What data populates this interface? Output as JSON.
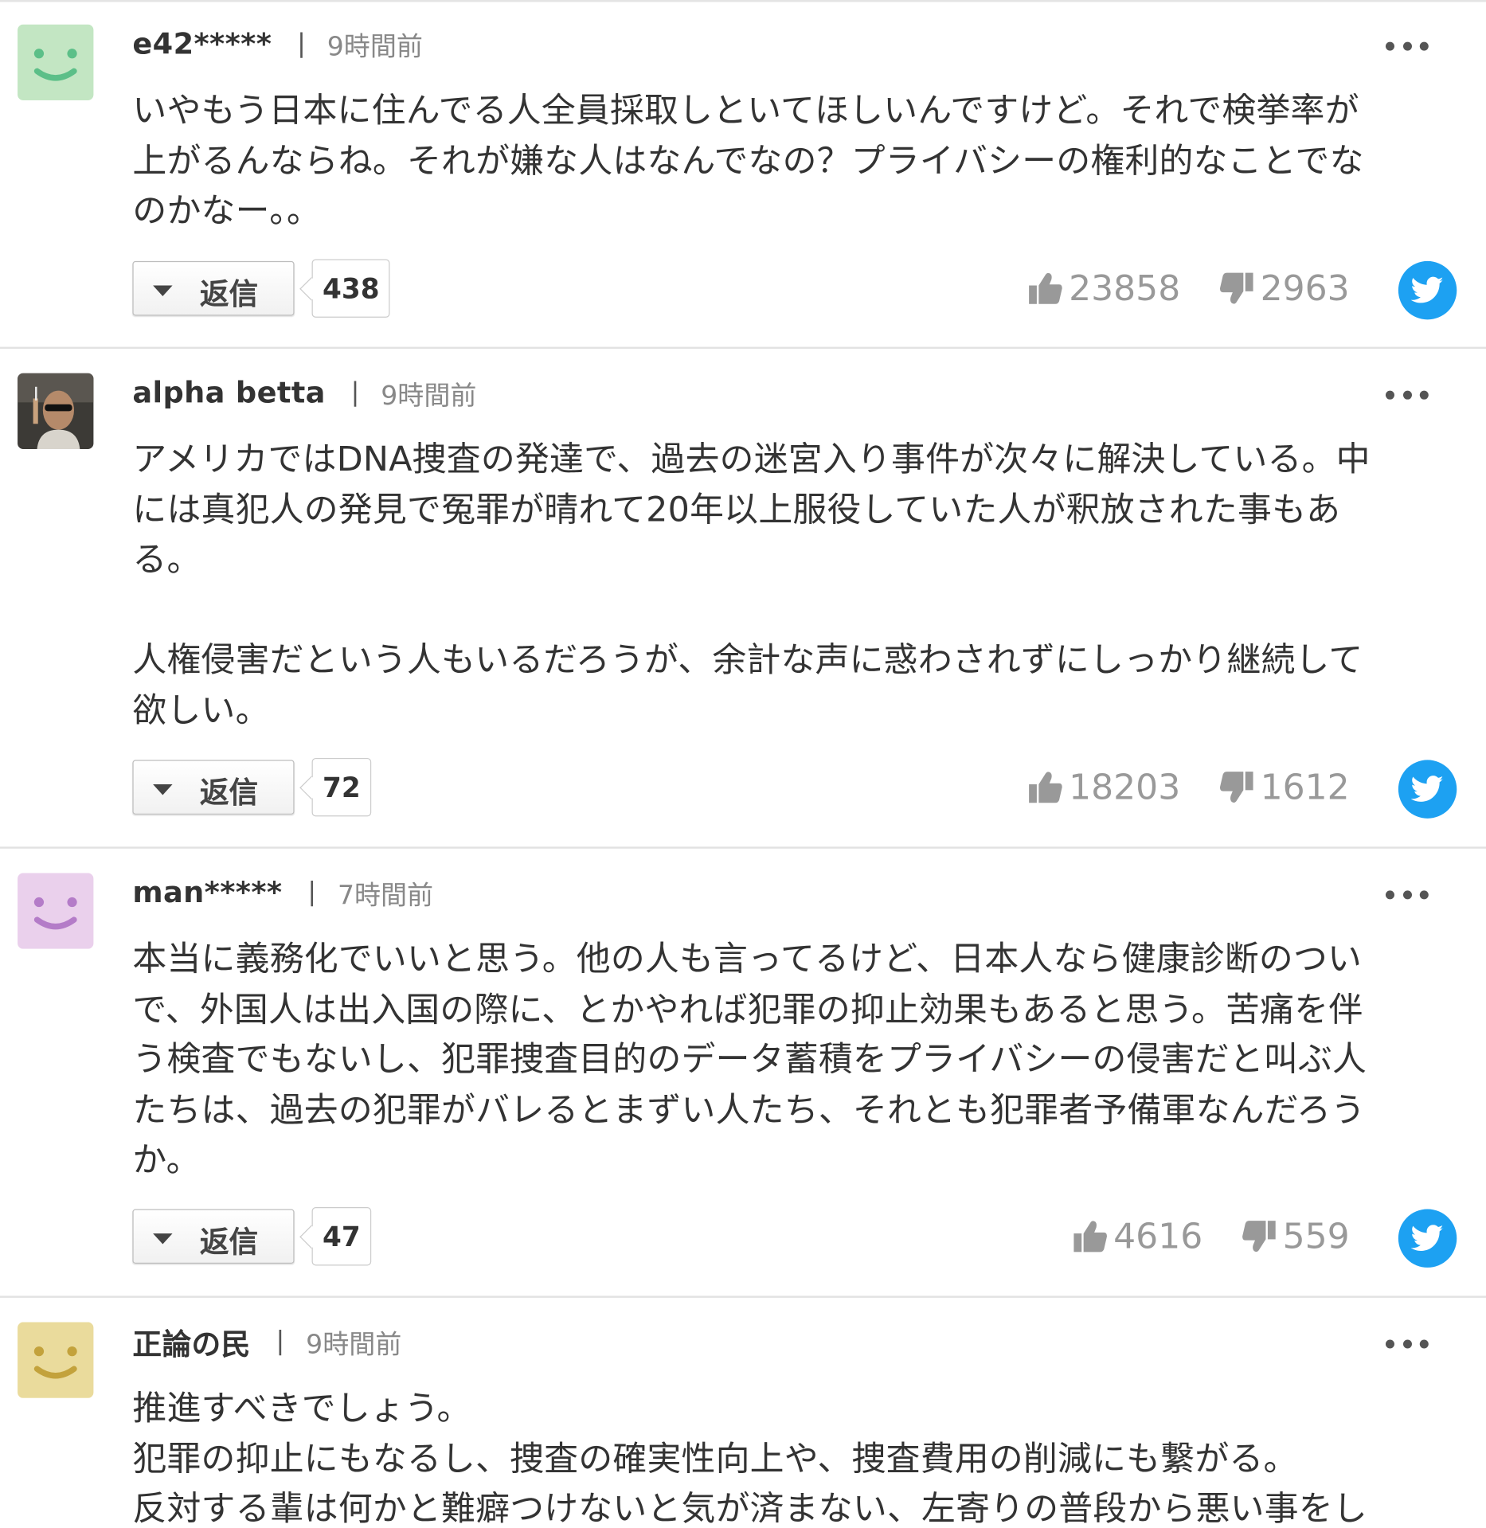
{
  "comments": [
    {
      "username": "e42*****",
      "separator": "|",
      "time": "9時間前",
      "avatar": "smiley-green",
      "text": "いやもう日本に住んでる人全員採取しといてほしいんですけど。それで検挙率が\n上がるんならね。それが嫌な人はなんでなの？プライバシーの権利的なことでな\nのかなー。。",
      "reply_label": "返信",
      "reply_count": "438",
      "likes": "23858",
      "dislikes": "2963"
    },
    {
      "username": "alpha betta",
      "separator": "|",
      "time": "9時間前",
      "avatar": "photo-man-sunglasses",
      "text": "アメリカではDNA捜査の発達で、過去の迷宮入り事件が次々に解決している。中\nには真犯人の発見で冤罪が晴れて20年以上服役していた人が釈放された事もあ\nる。\n\n人権侵害だという人もいるだろうが、余計な声に惑わされずにしっかり継続して\n欲しい。",
      "reply_label": "返信",
      "reply_count": "72",
      "likes": "18203",
      "dislikes": "1612"
    },
    {
      "username": "man*****",
      "separator": "|",
      "time": "7時間前",
      "avatar": "smiley-purple",
      "text": "本当に義務化でいいと思う。他の人も言ってるけど、日本人なら健康診断のつい\nで、外国人は出入国の際に、とかやれば犯罪の抑止効果もあると思う。苦痛を伴\nう検査でもないし、犯罪捜査目的のデータ蓄積をプライバシーの侵害だと叫ぶ人\nたちは、過去の犯罪がバレるとまずい人たち、それとも犯罪者予備軍なんだろう\nか。",
      "reply_label": "返信",
      "reply_count": "47",
      "likes": "4616",
      "dislikes": "559"
    },
    {
      "username": "正論の民",
      "separator": "|",
      "time": "9時間前",
      "avatar": "smiley-yellow",
      "text": "推進すべきでしょう。\n犯罪の抑止にもなるし、捜査の確実性向上や、捜査費用の削減にも繋がる。\n反対する輩は何かと難癖つけないと気が済まない、左寄りの普段から悪い事をし"
    }
  ],
  "colors": {
    "twitter_blue": "#1da1f2",
    "smiley_green_bg": "#c3e6c3",
    "smiley_green_fg": "#5cbf88",
    "smiley_purple_bg": "#ead0ec",
    "smiley_purple_fg": "#b47cc8",
    "smiley_yellow_bg": "#eadb9c",
    "smiley_yellow_fg": "#c3a23c",
    "vote_gray": "#999999"
  },
  "icons": {
    "more": "more-dots-icon",
    "reply_toggle": "caret-down-icon",
    "like": "thumbs-up-icon",
    "dislike": "thumbs-down-icon",
    "share": "twitter-bird-icon"
  }
}
